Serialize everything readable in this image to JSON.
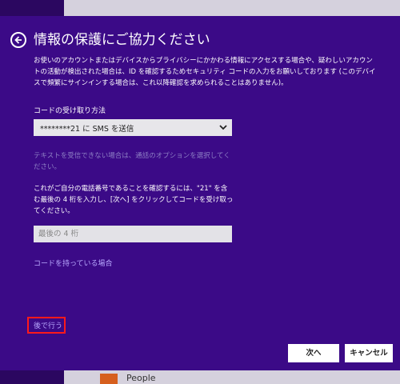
{
  "background": {
    "people_label": "People"
  },
  "dialog": {
    "title": "情報の保護にご協力ください",
    "description": "お使いのアカウントまたはデバイスからプライバシーにかかわる情報にアクセスする場合や、疑わしいアカウントの活動が検出された場合は、ID を確認するためセキュリティ コードの入力をお願いしております (このデバイスで頻繁にサインインする場合は、これ以降確認を求められることはありません)。",
    "method_label": "コードの受け取り方法",
    "method_selected": "********21 に SMS を送信",
    "hint_text": "テキストを受信できない場合は、通話のオプションを選択してください。",
    "confirm_text": "これがご自分の電話番号であることを確認するには、\"21\" を含む最後の 4 桁を入力し、[次へ] をクリックしてコードを受け取ってください。",
    "last4_placeholder": "最後の 4 桁",
    "have_code_link": "コードを持っている場合",
    "later_link": "後で行う",
    "next_button": "次へ",
    "cancel_button": "キャンセル"
  },
  "colors": {
    "dialog_bg": "#3b0a87",
    "link": "#b9a9ff",
    "highlight": "#ff1a1a"
  }
}
